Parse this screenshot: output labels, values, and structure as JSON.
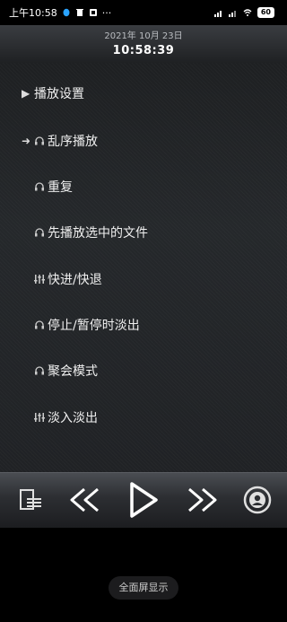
{
  "status_bar": {
    "time": "上午10:58",
    "dots": "···",
    "battery": "60"
  },
  "header": {
    "date": "2021年 10月 23日",
    "time": "10:58:39"
  },
  "menu": {
    "items": [
      {
        "label": "播放设置"
      },
      {
        "label": "乱序播放"
      },
      {
        "label": "重复"
      },
      {
        "label": "先播放选中的文件"
      },
      {
        "label": "快进/快退"
      },
      {
        "label": "停止/暂停时淡出"
      },
      {
        "label": "聚会模式"
      },
      {
        "label": "淡入淡出"
      }
    ]
  },
  "bottom": {
    "fullscreen_label": "全面屏显示"
  }
}
